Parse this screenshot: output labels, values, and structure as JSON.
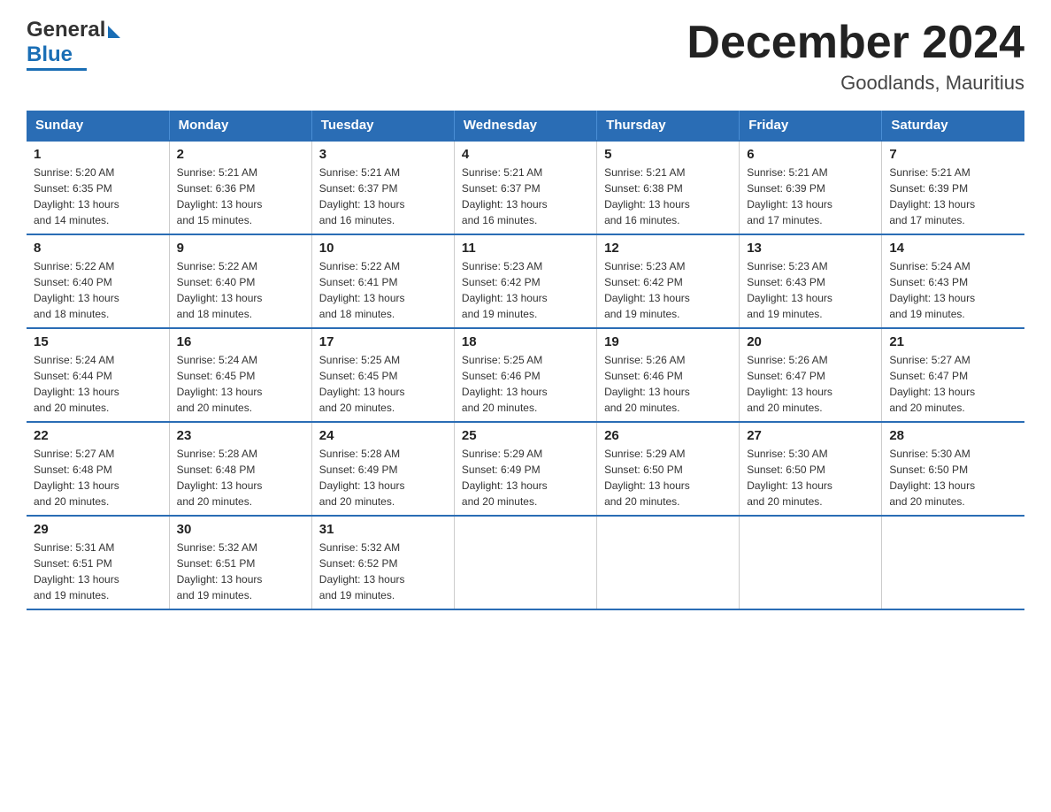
{
  "header": {
    "logo": {
      "general": "General",
      "blue": "Blue"
    },
    "title": "December 2024",
    "location": "Goodlands, Mauritius"
  },
  "calendar": {
    "days_of_week": [
      "Sunday",
      "Monday",
      "Tuesday",
      "Wednesday",
      "Thursday",
      "Friday",
      "Saturday"
    ],
    "weeks": [
      [
        {
          "day": "1",
          "info": "Sunrise: 5:20 AM\nSunset: 6:35 PM\nDaylight: 13 hours\nand 14 minutes."
        },
        {
          "day": "2",
          "info": "Sunrise: 5:21 AM\nSunset: 6:36 PM\nDaylight: 13 hours\nand 15 minutes."
        },
        {
          "day": "3",
          "info": "Sunrise: 5:21 AM\nSunset: 6:37 PM\nDaylight: 13 hours\nand 16 minutes."
        },
        {
          "day": "4",
          "info": "Sunrise: 5:21 AM\nSunset: 6:37 PM\nDaylight: 13 hours\nand 16 minutes."
        },
        {
          "day": "5",
          "info": "Sunrise: 5:21 AM\nSunset: 6:38 PM\nDaylight: 13 hours\nand 16 minutes."
        },
        {
          "day": "6",
          "info": "Sunrise: 5:21 AM\nSunset: 6:39 PM\nDaylight: 13 hours\nand 17 minutes."
        },
        {
          "day": "7",
          "info": "Sunrise: 5:21 AM\nSunset: 6:39 PM\nDaylight: 13 hours\nand 17 minutes."
        }
      ],
      [
        {
          "day": "8",
          "info": "Sunrise: 5:22 AM\nSunset: 6:40 PM\nDaylight: 13 hours\nand 18 minutes."
        },
        {
          "day": "9",
          "info": "Sunrise: 5:22 AM\nSunset: 6:40 PM\nDaylight: 13 hours\nand 18 minutes."
        },
        {
          "day": "10",
          "info": "Sunrise: 5:22 AM\nSunset: 6:41 PM\nDaylight: 13 hours\nand 18 minutes."
        },
        {
          "day": "11",
          "info": "Sunrise: 5:23 AM\nSunset: 6:42 PM\nDaylight: 13 hours\nand 19 minutes."
        },
        {
          "day": "12",
          "info": "Sunrise: 5:23 AM\nSunset: 6:42 PM\nDaylight: 13 hours\nand 19 minutes."
        },
        {
          "day": "13",
          "info": "Sunrise: 5:23 AM\nSunset: 6:43 PM\nDaylight: 13 hours\nand 19 minutes."
        },
        {
          "day": "14",
          "info": "Sunrise: 5:24 AM\nSunset: 6:43 PM\nDaylight: 13 hours\nand 19 minutes."
        }
      ],
      [
        {
          "day": "15",
          "info": "Sunrise: 5:24 AM\nSunset: 6:44 PM\nDaylight: 13 hours\nand 20 minutes."
        },
        {
          "day": "16",
          "info": "Sunrise: 5:24 AM\nSunset: 6:45 PM\nDaylight: 13 hours\nand 20 minutes."
        },
        {
          "day": "17",
          "info": "Sunrise: 5:25 AM\nSunset: 6:45 PM\nDaylight: 13 hours\nand 20 minutes."
        },
        {
          "day": "18",
          "info": "Sunrise: 5:25 AM\nSunset: 6:46 PM\nDaylight: 13 hours\nand 20 minutes."
        },
        {
          "day": "19",
          "info": "Sunrise: 5:26 AM\nSunset: 6:46 PM\nDaylight: 13 hours\nand 20 minutes."
        },
        {
          "day": "20",
          "info": "Sunrise: 5:26 AM\nSunset: 6:47 PM\nDaylight: 13 hours\nand 20 minutes."
        },
        {
          "day": "21",
          "info": "Sunrise: 5:27 AM\nSunset: 6:47 PM\nDaylight: 13 hours\nand 20 minutes."
        }
      ],
      [
        {
          "day": "22",
          "info": "Sunrise: 5:27 AM\nSunset: 6:48 PM\nDaylight: 13 hours\nand 20 minutes."
        },
        {
          "day": "23",
          "info": "Sunrise: 5:28 AM\nSunset: 6:48 PM\nDaylight: 13 hours\nand 20 minutes."
        },
        {
          "day": "24",
          "info": "Sunrise: 5:28 AM\nSunset: 6:49 PM\nDaylight: 13 hours\nand 20 minutes."
        },
        {
          "day": "25",
          "info": "Sunrise: 5:29 AM\nSunset: 6:49 PM\nDaylight: 13 hours\nand 20 minutes."
        },
        {
          "day": "26",
          "info": "Sunrise: 5:29 AM\nSunset: 6:50 PM\nDaylight: 13 hours\nand 20 minutes."
        },
        {
          "day": "27",
          "info": "Sunrise: 5:30 AM\nSunset: 6:50 PM\nDaylight: 13 hours\nand 20 minutes."
        },
        {
          "day": "28",
          "info": "Sunrise: 5:30 AM\nSunset: 6:50 PM\nDaylight: 13 hours\nand 20 minutes."
        }
      ],
      [
        {
          "day": "29",
          "info": "Sunrise: 5:31 AM\nSunset: 6:51 PM\nDaylight: 13 hours\nand 19 minutes."
        },
        {
          "day": "30",
          "info": "Sunrise: 5:32 AM\nSunset: 6:51 PM\nDaylight: 13 hours\nand 19 minutes."
        },
        {
          "day": "31",
          "info": "Sunrise: 5:32 AM\nSunset: 6:52 PM\nDaylight: 13 hours\nand 19 minutes."
        },
        {
          "day": "",
          "info": ""
        },
        {
          "day": "",
          "info": ""
        },
        {
          "day": "",
          "info": ""
        },
        {
          "day": "",
          "info": ""
        }
      ]
    ]
  }
}
